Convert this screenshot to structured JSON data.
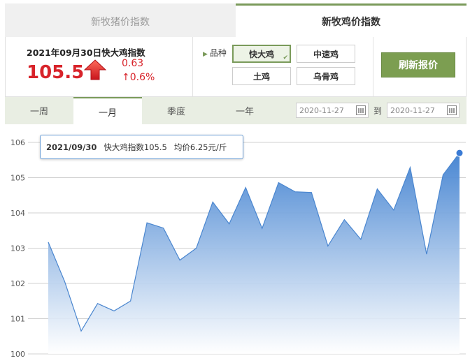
{
  "tabs": {
    "pig": "新牧猪价指数",
    "chicken": "新牧鸡价指数"
  },
  "index": {
    "title": "2021年09月30日快大鸡指数",
    "value": "105.5",
    "change": "0.63",
    "change_pct": "↑0.6%",
    "trend_icon": "up-arrow-icon",
    "color": "#d8232a"
  },
  "variety": {
    "label": "品种",
    "options": [
      "快大鸡",
      "中速鸡",
      "土鸡",
      "乌骨鸡"
    ],
    "selected": "快大鸡"
  },
  "refresh_label": "刷新报价",
  "periods": [
    "一周",
    "一月",
    "季度",
    "一年"
  ],
  "active_period": "一月",
  "date_range": {
    "from": "2020-11-27",
    "to_label": "到",
    "to": "2020-11-27"
  },
  "tooltip": {
    "date": "2021/09/30",
    "text": "快大鸡指数105.5",
    "price": "均价6.25元/斤"
  },
  "chart_data": {
    "type": "area",
    "title": "",
    "xlabel": "",
    "ylabel": "",
    "ylim": [
      100,
      106
    ],
    "yticks": [
      "100",
      "101",
      "102",
      "103",
      "104",
      "105",
      "106"
    ],
    "grid": true,
    "series": [
      {
        "values": [
          103.17,
          102.05,
          100.65,
          101.43,
          101.22,
          101.5,
          103.72,
          103.57,
          102.66,
          103.0,
          104.31,
          103.69,
          104.72,
          103.56,
          104.86,
          104.6,
          104.58,
          103.06,
          103.81,
          103.25,
          104.68,
          104.08,
          105.29,
          102.83,
          105.08,
          105.7
        ]
      }
    ],
    "colors": {
      "line": "#4a86cf",
      "fill_top": "#4e8fd8",
      "fill_bottom": "#ffffff",
      "grid": "#d0d0d0"
    }
  }
}
